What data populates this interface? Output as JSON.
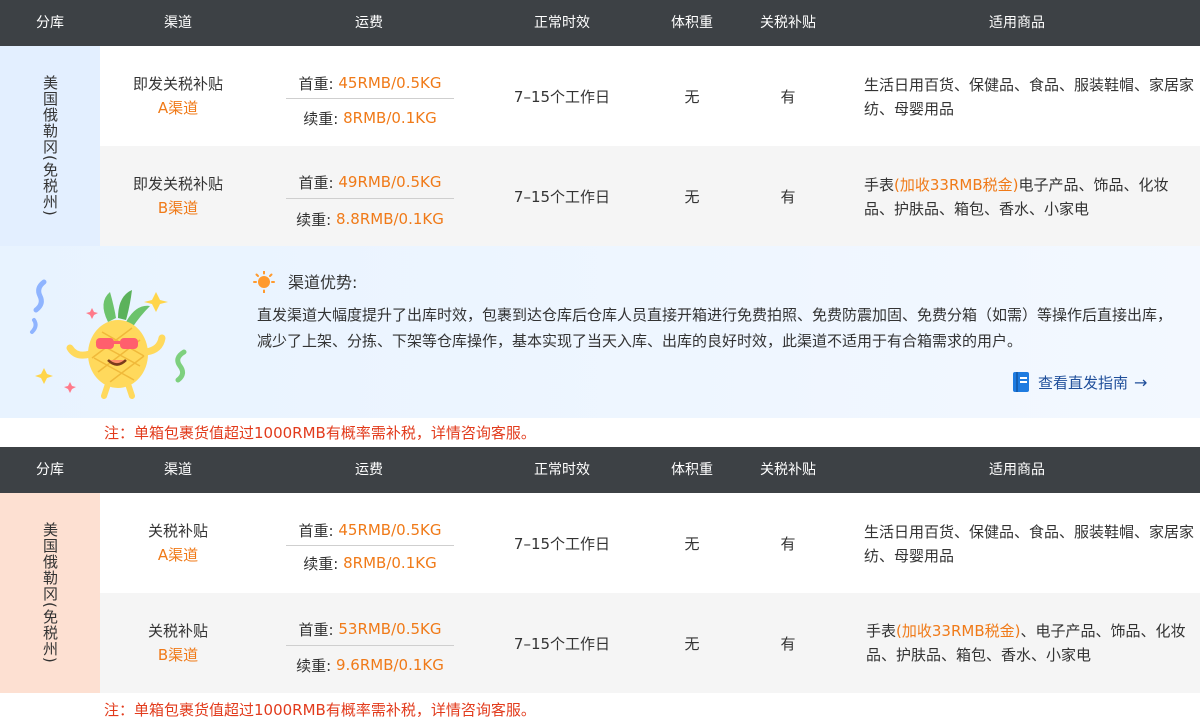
{
  "headers": [
    "分库",
    "渠道",
    "运费",
    "正常时效",
    "体积重",
    "关税补贴",
    "适用商品"
  ],
  "section1": {
    "warehouse": "美国俄勒冈(免税州)",
    "rows": [
      {
        "channel_line1": "即发关税补贴",
        "channel_line2": "A渠道",
        "fee_first_label": "首重:",
        "fee_first_value": "45RMB/0.5KG",
        "fee_add_label": "续重:",
        "fee_add_value": "8RMB/0.1KG",
        "time": "7–15个工作日",
        "volume": "无",
        "subsidy": "有",
        "goods_prefix": "生活日用百货、保健品、食品、服装鞋帽、家居家纺、母婴用品",
        "goods_highlight": "",
        "goods_suffix": ""
      },
      {
        "channel_line1": "即发关税补贴",
        "channel_line2": "B渠道",
        "fee_first_label": "首重:",
        "fee_first_value": "49RMB/0.5KG",
        "fee_add_label": "续重:",
        "fee_add_value": "8.8RMB/0.1KG",
        "time": "7–15个工作日",
        "volume": "无",
        "subsidy": "有",
        "goods_prefix": "手表",
        "goods_highlight": "(加收33RMB税金)",
        "goods_suffix": "电子产品、饰品、化妆品、护肤品、箱包、香水、小家电"
      }
    ]
  },
  "advantage": {
    "title": "渠道优势:",
    "text": "直发渠道大幅度提升了出库时效，包裹到达仓库后仓库人员直接开箱进行免费拍照、免费防震加固、免费分箱（如需）等操作后直接出库，减少了上架、分拣、下架等仓库操作，基本实现了当天入库、出库的良好时效，此渠道不适用于有合箱需求的用户。",
    "guide_label": "查看直发指南",
    "guide_arrow": "→"
  },
  "note": "注：单箱包裹货值超过1000RMB有概率需补税，详情咨询客服。",
  "section2": {
    "warehouse": "美国俄勒冈(免税州)",
    "rows": [
      {
        "channel_line1": "关税补贴",
        "channel_line2": "A渠道",
        "fee_first_label": "首重:",
        "fee_first_value": "45RMB/0.5KG",
        "fee_add_label": "续重:",
        "fee_add_value": "8RMB/0.1KG",
        "time": "7–15个工作日",
        "volume": "无",
        "subsidy": "有",
        "goods_prefix": "生活日用百货、保健品、食品、服装鞋帽、家居家纺、母婴用品",
        "goods_highlight": "",
        "goods_suffix": ""
      },
      {
        "channel_line1": "关税补贴",
        "channel_line2": "B渠道",
        "fee_first_label": "首重:",
        "fee_first_value": "53RMB/0.5KG",
        "fee_add_label": "续重:",
        "fee_add_value": "9.6RMB/0.1KG",
        "time": "7–15个工作日",
        "volume": "无",
        "subsidy": "有",
        "goods_prefix": "手表",
        "goods_highlight": "(加收33RMB税金)",
        "goods_suffix": "、电子产品、饰品、化妆品、护肤品、箱包、香水、小家电"
      }
    ]
  },
  "colors": {
    "header_bg": "#3d4145",
    "accent_orange": "#f07a18",
    "note_red": "#e23b1c",
    "warehouse1_bg": "#e3efff",
    "warehouse2_bg": "#fde0d2",
    "link_blue": "#1f4e9a"
  },
  "icons": [
    "sun-icon",
    "book-icon",
    "arrow-right-icon",
    "pineapple-mascot"
  ]
}
